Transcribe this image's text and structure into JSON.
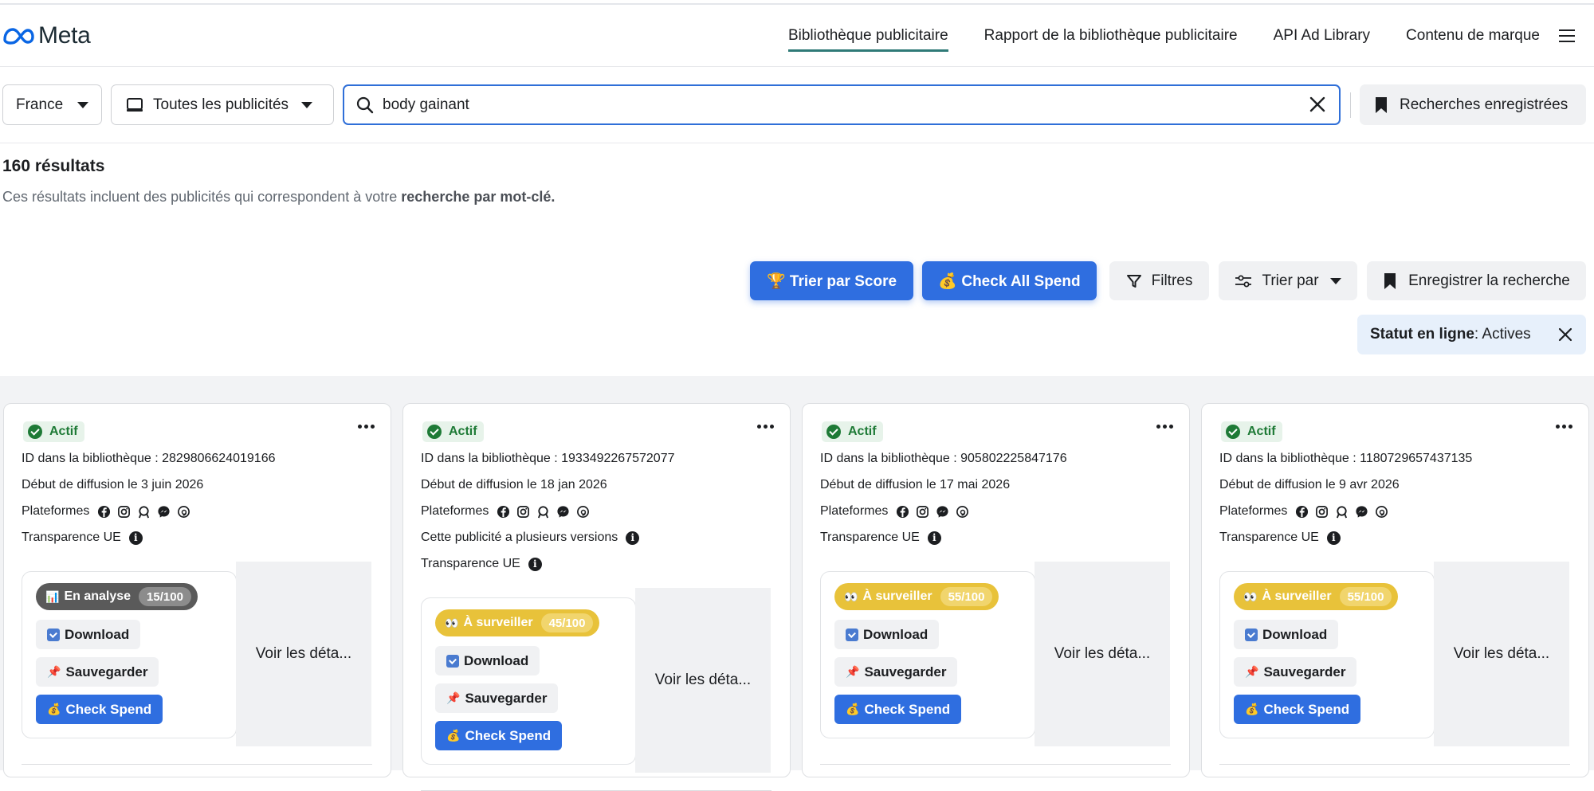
{
  "header": {
    "logo_text": "Meta",
    "nav": [
      {
        "label": "Bibliothèque publicitaire"
      },
      {
        "label": "Rapport de la bibliothèque publicitaire"
      },
      {
        "label": "API Ad Library"
      },
      {
        "label": "Contenu de marque"
      }
    ]
  },
  "search": {
    "country": "France",
    "ad_type": "Toutes les publicités",
    "query": "body gainant",
    "saved_label": "Recherches enregistrées"
  },
  "results": {
    "count": "160 résultats",
    "desc_prefix": "Ces résultats incluent des publicités qui correspondent à votre ",
    "desc_bold": "recherche par mot-clé."
  },
  "actions": {
    "sort_score": "🏆 Trier par Score",
    "check_all": "💰 Check All Spend",
    "filters": "Filtres",
    "sort_by": "Trier par",
    "save_search": "Enregistrer la recherche"
  },
  "status_chip": {
    "label": "Statut en ligne",
    "value": " : Actives"
  },
  "card_common": {
    "status": "Actif",
    "platforms_label": "Plateformes",
    "transparency": "Transparence UE",
    "download": "Download",
    "save": "Sauvegarder",
    "check_spend": "Check Spend",
    "details": "Voir les déta..."
  },
  "cards": [
    {
      "id": "ID dans la bibliothèque : 2829806624019166",
      "start": "Début de diffusion le 3 juin 2026",
      "versions": "",
      "score_label": "En analyse",
      "score_emoji": "📊",
      "score": "15/100",
      "score_color": "#5a5a5a",
      "platforms": [
        "facebook-icon",
        "instagram-icon",
        "audience-network-icon",
        "messenger-icon",
        "threads-icon"
      ]
    },
    {
      "id": "ID dans la bibliothèque : 1933492267572077",
      "start": "Début de diffusion le 18 jan 2026",
      "versions": "Cette publicité a plusieurs versions",
      "score_label": "À surveiller",
      "score_emoji": "👀",
      "score": "45/100",
      "score_color": "#e8c23a",
      "platforms": [
        "facebook-icon",
        "instagram-icon",
        "audience-network-icon",
        "messenger-icon",
        "threads-icon"
      ]
    },
    {
      "id": "ID dans la bibliothèque : 905802225847176",
      "start": "Début de diffusion le 17 mai 2026",
      "versions": "",
      "score_label": "À surveiller",
      "score_emoji": "👀",
      "score": "55/100",
      "score_color": "#e8c23a",
      "platforms": [
        "facebook-icon",
        "instagram-icon",
        "messenger-icon",
        "threads-icon"
      ]
    },
    {
      "id": "ID dans la bibliothèque : 1180729657437135",
      "start": "Début de diffusion le 9 avr 2026",
      "versions": "",
      "score_label": "À surveiller",
      "score_emoji": "👀",
      "score": "55/100",
      "score_color": "#e8c23a",
      "platforms": [
        "facebook-icon",
        "instagram-icon",
        "audience-network-icon",
        "messenger-icon",
        "threads-icon"
      ]
    }
  ]
}
